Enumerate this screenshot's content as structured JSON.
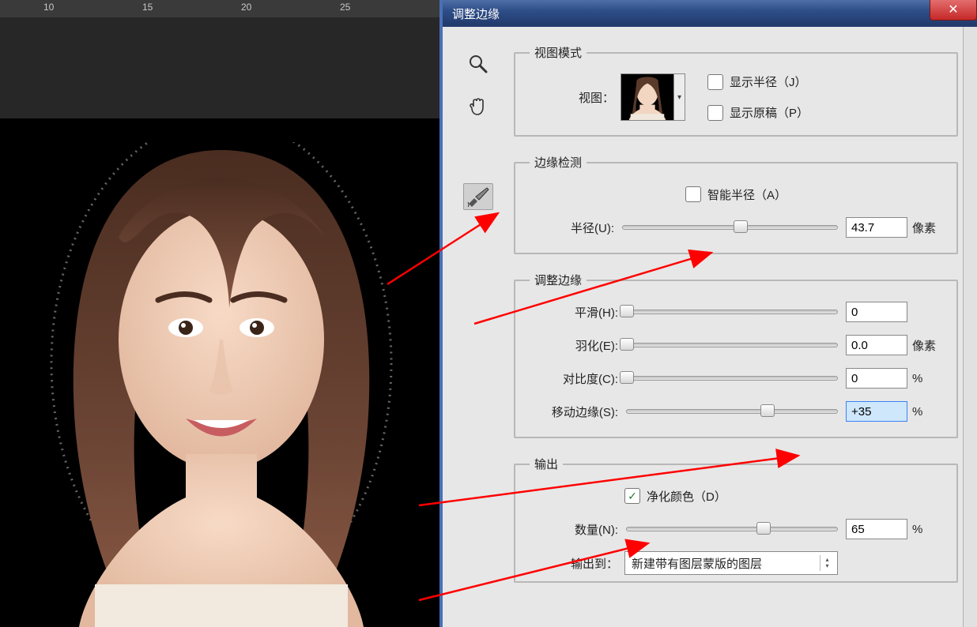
{
  "ruler_numbers": [
    10,
    15,
    20,
    25
  ],
  "dialog": {
    "title": "调整边缘",
    "close_label": "✕"
  },
  "tools": {
    "zoom": "🔍",
    "hand": "✋",
    "brush": "🖌"
  },
  "view_mode": {
    "legend": "视图模式",
    "view_label": "视图：",
    "show_radius": "显示半径（J）",
    "show_original": "显示原稿（P）"
  },
  "edge_detect": {
    "legend": "边缘检测",
    "smart_radius": "智能半径（A）",
    "radius_label": "半径(U):",
    "radius_value": "43.7",
    "radius_unit": "像素",
    "radius_pct": 55
  },
  "adjust_edge": {
    "legend": "调整边缘",
    "smooth_label": "平滑(H):",
    "smooth_value": "0",
    "smooth_pct": 0,
    "feather_label": "羽化(E):",
    "feather_value": "0.0",
    "feather_unit": "像素",
    "feather_pct": 0,
    "contrast_label": "对比度(C):",
    "contrast_value": "0",
    "contrast_unit": "%",
    "contrast_pct": 0,
    "shift_label": "移动边缘(S):",
    "shift_value": "+35",
    "shift_unit": "%",
    "shift_pct": 67
  },
  "output": {
    "legend": "输出",
    "purify": "净化颜色（D）",
    "purify_checked": true,
    "amount_label": "数量(N):",
    "amount_value": "65",
    "amount_unit": "%",
    "amount_pct": 65,
    "output_to_label": "输出到：",
    "output_to_value": "新建带有图层蒙版的图层"
  }
}
